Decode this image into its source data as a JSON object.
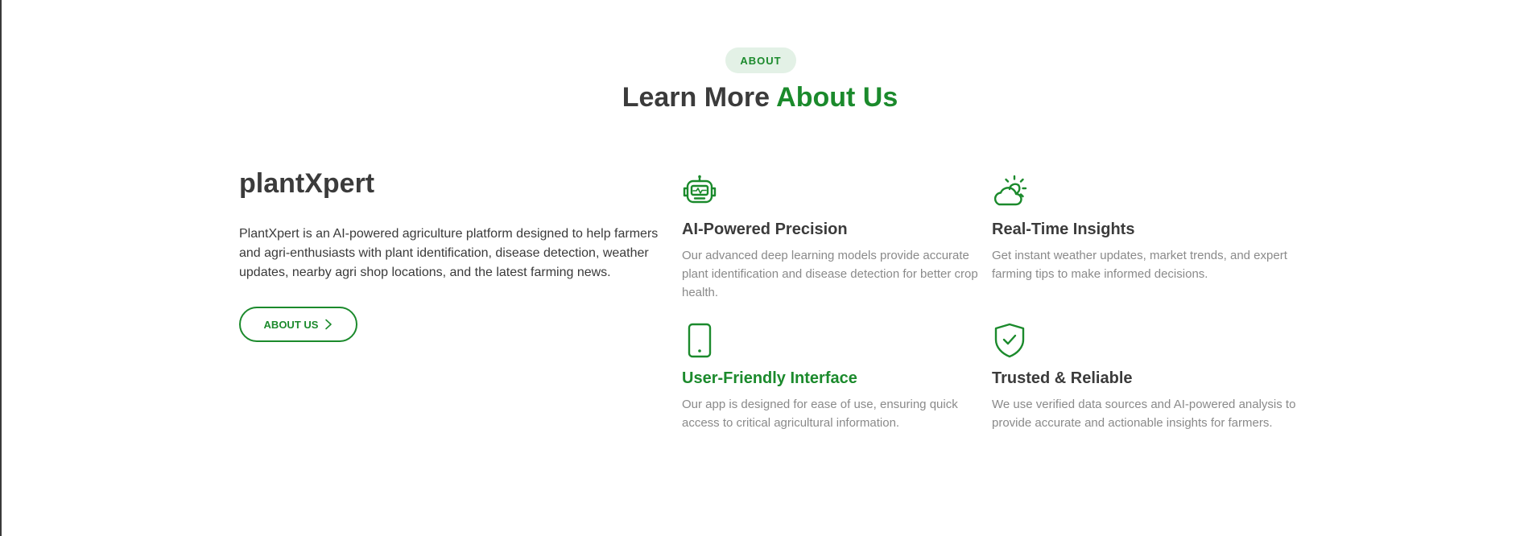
{
  "section": {
    "badge": "ABOUT",
    "heading_prefix": "Learn More",
    "heading_accent": "About Us"
  },
  "intro": {
    "brand": "plantXpert",
    "description": "PlantXpert is an AI-powered agriculture platform designed to help farmers and agri-enthusiasts with plant identification, disease detection, weather updates, nearby agri shop locations, and the latest farming news.",
    "button_label": "ABOUT US"
  },
  "features": [
    {
      "icon": "robot-icon",
      "title": "AI-Powered Precision",
      "text": "Our advanced deep learning models provide accurate plant identification and disease detection for better crop health."
    },
    {
      "icon": "sun-cloud-icon",
      "title": "Real-Time Insights",
      "text": "Get instant weather updates, market trends, and expert farming tips to make informed decisions."
    },
    {
      "icon": "phone-icon",
      "title": "User-Friendly Interface",
      "text": "Our app is designed for ease of use, ensuring quick access to critical agricultural information."
    },
    {
      "icon": "shield-check-icon",
      "title": "Trusted & Reliable",
      "text": "We use verified data sources and AI-powered analysis to provide accurate and actionable insights for farmers."
    }
  ],
  "colors": {
    "accent": "#1b8a2c",
    "badge_bg": "#e3f1e6",
    "heading": "#3b3b3b",
    "muted_text": "#8a8a8a"
  }
}
